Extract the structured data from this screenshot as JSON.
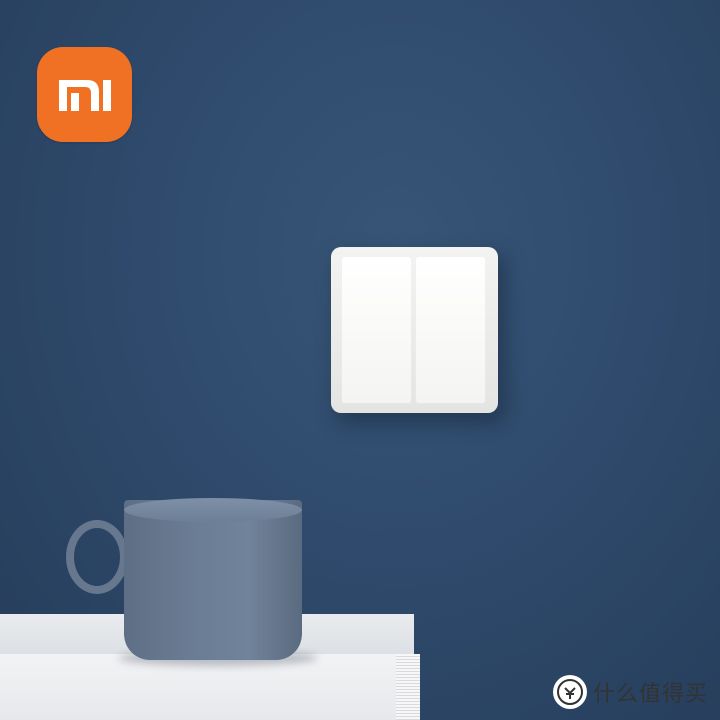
{
  "brand": {
    "logo_text": "mi",
    "logo_color": "#f07124"
  },
  "scene": {
    "wall_color": "#2f4a6c",
    "switch_color": "#f2f2f0",
    "mug_color": "#6b7d94",
    "shelf_color": "#e6e8eb"
  },
  "watermark": {
    "icon": "value-icon",
    "text": "什么值得买"
  }
}
